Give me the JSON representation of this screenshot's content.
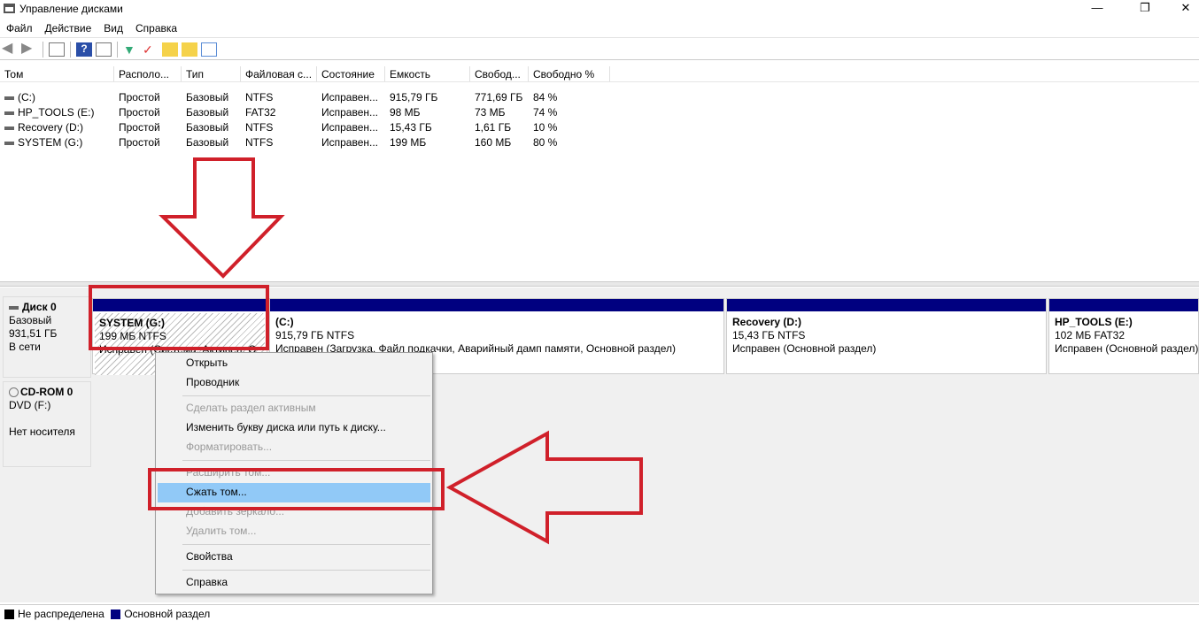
{
  "window": {
    "title": "Управление дисками"
  },
  "menu": [
    "Файл",
    "Действие",
    "Вид",
    "Справка"
  ],
  "table": {
    "headers": [
      "Том",
      "Располо...",
      "Тип",
      "Файловая с...",
      "Состояние",
      "Емкость",
      "Свобод...",
      "Свободно %"
    ],
    "rows": [
      [
        "(C:)",
        "Простой",
        "Базовый",
        "NTFS",
        "Исправен...",
        "915,79 ГБ",
        "771,69 ГБ",
        "84 %"
      ],
      [
        "HP_TOOLS (E:)",
        "Простой",
        "Базовый",
        "FAT32",
        "Исправен...",
        "98 МБ",
        "73 МБ",
        "74 %"
      ],
      [
        "Recovery (D:)",
        "Простой",
        "Базовый",
        "NTFS",
        "Исправен...",
        "15,43 ГБ",
        "1,61 ГБ",
        "10 %"
      ],
      [
        "SYSTEM (G:)",
        "Простой",
        "Базовый",
        "NTFS",
        "Исправен...",
        "199 МБ",
        "160 МБ",
        "80 %"
      ]
    ]
  },
  "disk0": {
    "name": "Диск 0",
    "type": "Базовый",
    "size": "931,51 ГБ",
    "status": "В сети",
    "partitions": [
      {
        "name": "SYSTEM  (G:)",
        "size": "199 МБ NTFS",
        "status": "Исправен (Система, Активен, О"
      },
      {
        "name": "(C:)",
        "size": "915,79 ГБ NTFS",
        "status": "Исправен (Загрузка, Файл подкачки, Аварийный дамп памяти, Основной раздел)"
      },
      {
        "name": "Recovery  (D:)",
        "size": "15,43 ГБ NTFS",
        "status": "Исправен (Основной раздел)"
      },
      {
        "name": "HP_TOOLS  (E:)",
        "size": "102 МБ FAT32",
        "status": "Исправен (Основной раздел)"
      }
    ]
  },
  "cdrom": {
    "name": "CD-ROM 0",
    "type": "DVD (F:)",
    "status": "Нет носителя"
  },
  "context_menu": {
    "items": [
      "Открыть",
      "Проводник",
      "Сделать раздел активным",
      "Изменить букву диска или путь к диску...",
      "Форматировать...",
      "Расширить том...",
      "Сжать том...",
      "Добавить зеркало...",
      "Удалить том...",
      "Свойства",
      "Справка"
    ]
  },
  "legend": [
    "Не распределена",
    "Основной раздел"
  ],
  "colors": {
    "primary": "#000080",
    "unallocated": "#000000",
    "highlight": "#91c9f7",
    "annotation": "#d0202a"
  }
}
